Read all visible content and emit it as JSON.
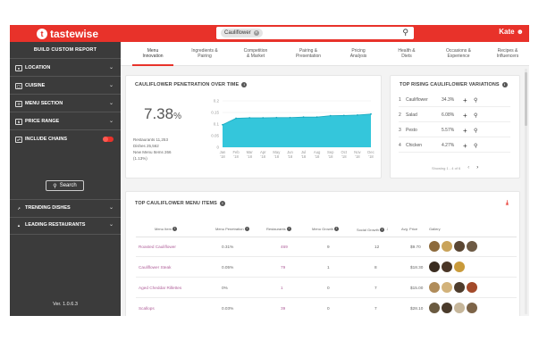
{
  "app": {
    "brand": "tastewise",
    "user": "Kate"
  },
  "search": {
    "chip": "Cauliflower"
  },
  "sidebar": {
    "title": "BUILD CUSTOM REPORT",
    "items": [
      {
        "label": "LOCATION",
        "icon": "location-icon"
      },
      {
        "label": "CUISINE",
        "icon": "cuisine-icon"
      },
      {
        "label": "MENU SECTION",
        "icon": "menu-section-icon"
      },
      {
        "label": "PRICE RANGE",
        "icon": "price-range-icon"
      },
      {
        "label": "INCLUDE CHAINS",
        "icon": "chains-icon"
      },
      {
        "label": "TRENDING DISHES",
        "icon": "trending-icon"
      },
      {
        "label": "LEADING RESTAURANTS",
        "icon": "restaurant-icon"
      }
    ],
    "search_button": "Search",
    "version": "Ver. 1.0.6.3"
  },
  "tabs": [
    {
      "line1": "Menu",
      "line2": "Innovation"
    },
    {
      "line1": "Ingredients &",
      "line2": "Pairing"
    },
    {
      "line1": "Competition",
      "line2": "& Market"
    },
    {
      "line1": "Pairing &",
      "line2": "Presentation"
    },
    {
      "line1": "Pricing",
      "line2": "Analysis"
    },
    {
      "line1": "Health &",
      "line2": "Diets"
    },
    {
      "line1": "Occasions &",
      "line2": "Experience"
    },
    {
      "line1": "Recipes &",
      "line2": "Influencers"
    }
  ],
  "penetration": {
    "title": "CAULIFLOWER PENETRATION OVER TIME",
    "value": "7.38",
    "unit": "%",
    "stats": [
      "Restaurants 11,253",
      "Dishes 25,562",
      "New Menu Items 266",
      "(1.13%)"
    ]
  },
  "chart_data": {
    "type": "area",
    "title": "",
    "x": [
      "Jan '18",
      "Feb '18",
      "Mar '18",
      "Apr '18",
      "May '18",
      "Jun '18",
      "Jul '18",
      "Aug '18",
      "Sep '18",
      "Oct '18",
      "Nov '18",
      "Dec '18"
    ],
    "x_labels_top": [
      "Jan",
      "Feb",
      "Mar",
      "Apr",
      "May",
      "Jun",
      "Jul",
      "Aug",
      "Sep",
      "Oct",
      "Nov",
      "Dec"
    ],
    "x_labels_bottom": [
      "'18",
      "'18",
      "'18",
      "'18",
      "'18",
      "'18",
      "'18",
      "'18",
      "'18",
      "'18",
      "'18",
      "'18"
    ],
    "y_ticks": [
      "0.2",
      "0.15",
      "0.1",
      "0.05",
      "0"
    ],
    "ylim": [
      0,
      0.2
    ],
    "series": [
      {
        "values": [
          0.097,
          0.125,
          0.127,
          0.127,
          0.128,
          0.128,
          0.13,
          0.13,
          0.136,
          0.137,
          0.139,
          0.143
        ]
      }
    ],
    "color": "#29c3d9",
    "grid": true
  },
  "variations": {
    "title": "TOP RISING CAULIFLOWER VARIATIONS",
    "rows": [
      {
        "rank": "1",
        "name": "Cauliflower",
        "value": "34.3%"
      },
      {
        "rank": "2",
        "name": "Salad",
        "value": "6.08%"
      },
      {
        "rank": "3",
        "name": "Pesto",
        "value": "5.57%"
      },
      {
        "rank": "4",
        "name": "Chicken",
        "value": "4.27%"
      }
    ],
    "pager": "Showing 1 - 4 of 6"
  },
  "menu_items": {
    "title": "TOP CAULIFLOWER MENU ITEMS",
    "headers": [
      "Menu Item",
      "Menu Penetration",
      "Restaurants",
      "Menu Growth",
      "Social Growth",
      "Avg. Price",
      "Gallery"
    ],
    "rows": [
      {
        "item": "Roasted Cauliflower",
        "penetration": "0.31%",
        "restaurants": "469",
        "menu_growth": "9",
        "social_growth": "12",
        "price": "$9.70"
      },
      {
        "item": "Cauliflower Steak",
        "penetration": "0.05%",
        "restaurants": "79",
        "menu_growth": "1",
        "social_growth": "8",
        "price": "$18.30"
      },
      {
        "item": "Aged Cheddar Rillettes",
        "penetration": "0%",
        "restaurants": "1",
        "menu_growth": "0",
        "social_growth": "7",
        "price": "$15.00"
      },
      {
        "item": "Scallops",
        "penetration": "0.03%",
        "restaurants": "39",
        "menu_growth": "0",
        "social_growth": "7",
        "price": "$28.10"
      }
    ]
  },
  "colors": {
    "brand": "#e8322a",
    "sidebar": "#3b3b3b",
    "chart": "#29c3d9",
    "link": "#b0609a"
  }
}
